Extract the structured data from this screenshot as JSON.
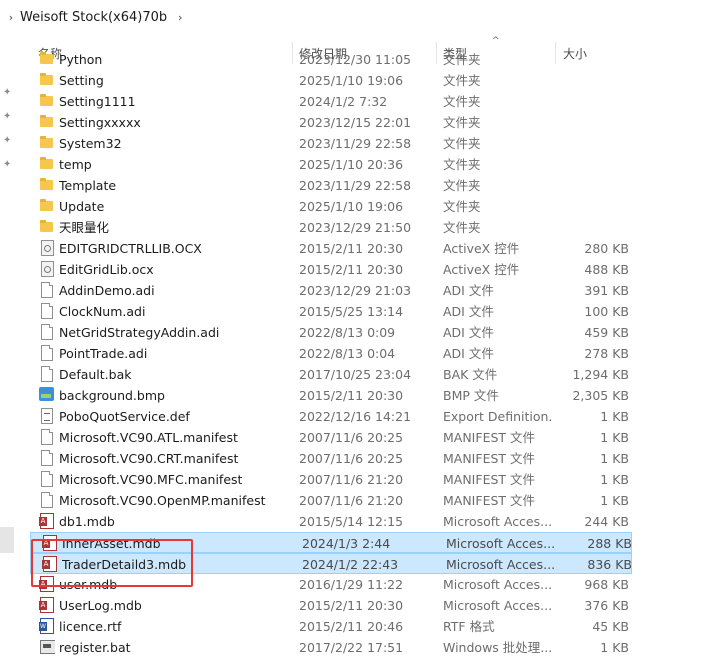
{
  "breadcrumb": {
    "items": [
      "Weisoft Stock(x64)70b"
    ]
  },
  "columns": {
    "name": "名称",
    "date": "修改日期",
    "type": "类型",
    "size": "大小"
  },
  "rows": [
    {
      "name": "Python",
      "date": "2023/12/30 11:05",
      "type": "文件夹",
      "size": "",
      "icon": "folder-icon"
    },
    {
      "name": "Setting",
      "date": "2025/1/10 19:06",
      "type": "文件夹",
      "size": "",
      "icon": "folder-icon"
    },
    {
      "name": "Setting1111",
      "date": "2024/1/2 7:32",
      "type": "文件夹",
      "size": "",
      "icon": "folder-icon"
    },
    {
      "name": "Settingxxxxx",
      "date": "2023/12/15 22:01",
      "type": "文件夹",
      "size": "",
      "icon": "folder-icon"
    },
    {
      "name": "System32",
      "date": "2023/11/29 22:58",
      "type": "文件夹",
      "size": "",
      "icon": "folder-icon"
    },
    {
      "name": "temp",
      "date": "2025/1/10 20:36",
      "type": "文件夹",
      "size": "",
      "icon": "folder-icon"
    },
    {
      "name": "Template",
      "date": "2023/11/29 22:58",
      "type": "文件夹",
      "size": "",
      "icon": "folder-icon"
    },
    {
      "name": "Update",
      "date": "2025/1/10 19:06",
      "type": "文件夹",
      "size": "",
      "icon": "folder-icon"
    },
    {
      "name": "天眼量化",
      "date": "2023/12/29 21:50",
      "type": "文件夹",
      "size": "",
      "icon": "folder-icon"
    },
    {
      "name": "EDITGRIDCTRLLIB.OCX",
      "date": "2015/2/11 20:30",
      "type": "ActiveX 控件",
      "size": "280 KB",
      "icon": "activex-icon"
    },
    {
      "name": "EditGridLib.ocx",
      "date": "2015/2/11 20:30",
      "type": "ActiveX 控件",
      "size": "488 KB",
      "icon": "activex-icon"
    },
    {
      "name": "AddinDemo.adi",
      "date": "2023/12/29 21:03",
      "type": "ADI 文件",
      "size": "391 KB",
      "icon": "file-icon"
    },
    {
      "name": "ClockNum.adi",
      "date": "2015/5/25 13:14",
      "type": "ADI 文件",
      "size": "100 KB",
      "icon": "file-icon"
    },
    {
      "name": "NetGridStrategyAddin.adi",
      "date": "2022/8/13 0:09",
      "type": "ADI 文件",
      "size": "459 KB",
      "icon": "file-icon"
    },
    {
      "name": "PointTrade.adi",
      "date": "2022/8/13 0:04",
      "type": "ADI 文件",
      "size": "278 KB",
      "icon": "file-icon"
    },
    {
      "name": "Default.bak",
      "date": "2017/10/25 23:04",
      "type": "BAK 文件",
      "size": "1,294 KB",
      "icon": "file-icon"
    },
    {
      "name": "background.bmp",
      "date": "2015/2/11 20:30",
      "type": "BMP 文件",
      "size": "2,305 KB",
      "icon": "image-icon"
    },
    {
      "name": "PoboQuotService.def",
      "date": "2022/12/16 14:21",
      "type": "Export Definition...",
      "size": "1 KB",
      "icon": "text-file-icon"
    },
    {
      "name": "Microsoft.VC90.ATL.manifest",
      "date": "2007/11/6 20:25",
      "type": "MANIFEST 文件",
      "size": "1 KB",
      "icon": "file-icon"
    },
    {
      "name": "Microsoft.VC90.CRT.manifest",
      "date": "2007/11/6 20:25",
      "type": "MANIFEST 文件",
      "size": "1 KB",
      "icon": "file-icon"
    },
    {
      "name": "Microsoft.VC90.MFC.manifest",
      "date": "2007/11/6 21:20",
      "type": "MANIFEST 文件",
      "size": "1 KB",
      "icon": "file-icon"
    },
    {
      "name": "Microsoft.VC90.OpenMP.manifest",
      "date": "2007/11/6 21:20",
      "type": "MANIFEST 文件",
      "size": "1 KB",
      "icon": "file-icon"
    },
    {
      "name": "db1.mdb",
      "date": "2015/5/14 12:15",
      "type": "Microsoft Acces...",
      "size": "244 KB",
      "icon": "access-db-icon"
    },
    {
      "name": "InnerAsset.mdb",
      "date": "2024/1/3 2:44",
      "type": "Microsoft Acces...",
      "size": "288 KB",
      "icon": "access-db-icon",
      "selected": true
    },
    {
      "name": "TraderDetaild3.mdb",
      "date": "2024/1/2 22:43",
      "type": "Microsoft Acces...",
      "size": "836 KB",
      "icon": "access-db-icon",
      "selected": true
    },
    {
      "name": "user.mdb",
      "date": "2016/1/29 11:22",
      "type": "Microsoft Acces...",
      "size": "968 KB",
      "icon": "access-db-icon"
    },
    {
      "name": "UserLog.mdb",
      "date": "2015/2/11 20:30",
      "type": "Microsoft Acces...",
      "size": "376 KB",
      "icon": "access-db-icon"
    },
    {
      "name": "licence.rtf",
      "date": "2015/2/11 20:46",
      "type": "RTF 格式",
      "size": "45 KB",
      "icon": "word-doc-icon"
    },
    {
      "name": "register.bat",
      "date": "2017/2/22 17:51",
      "type": "Windows 批处理...",
      "size": "1 KB",
      "icon": "batch-file-icon"
    }
  ],
  "colors": {
    "selection_bg": "#cce8ff",
    "selection_border": "#99d1ff",
    "highlight": "#e53935",
    "folder": "#f7c64d"
  }
}
